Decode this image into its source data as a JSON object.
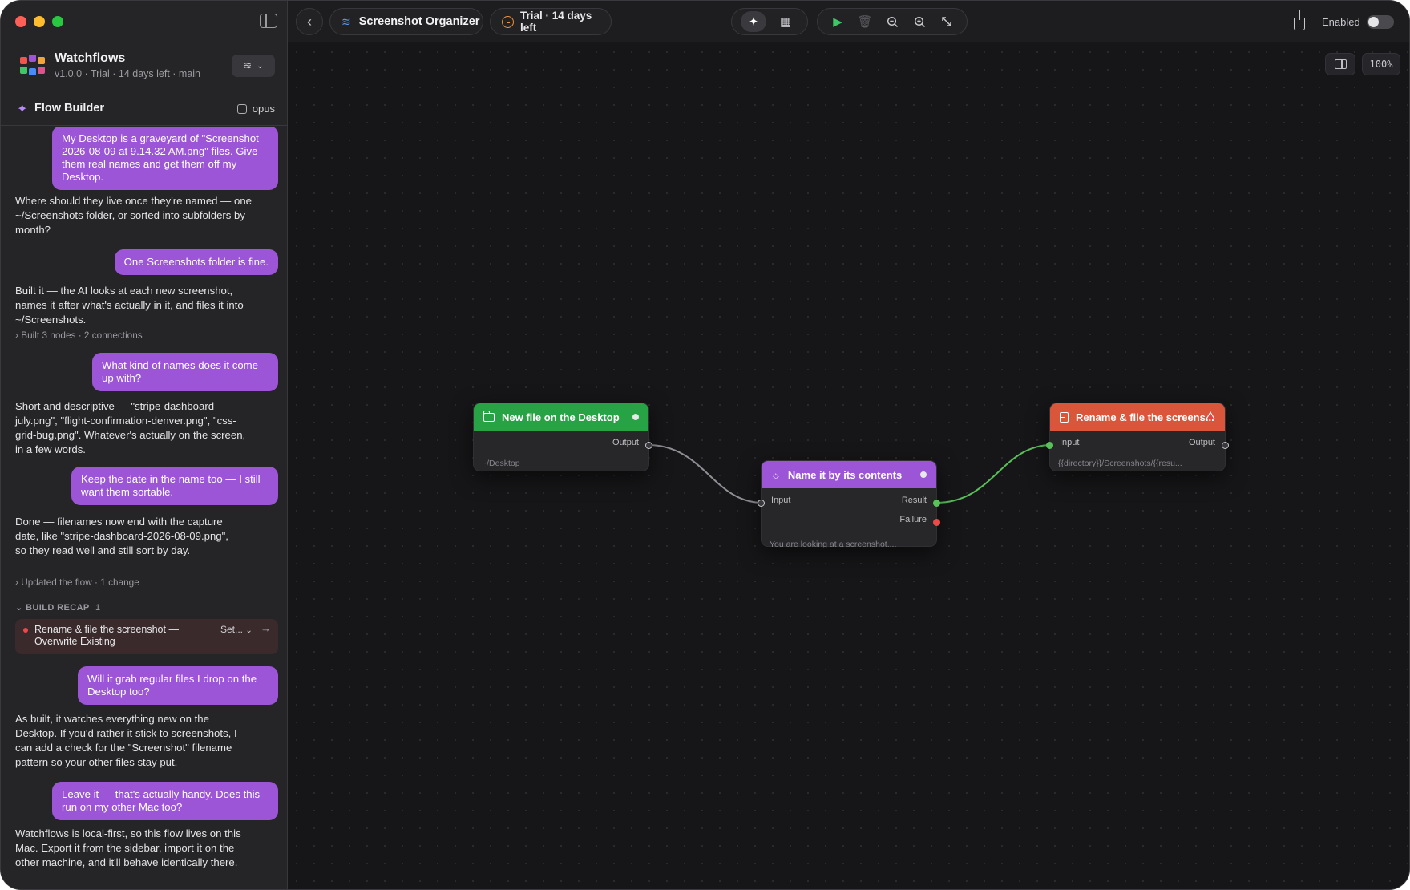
{
  "app": {
    "name": "Watchflows",
    "subtitle": "v1.0.0 · Trial · 14 days left · main",
    "menu_icon": "filter-icon"
  },
  "flow_builder": {
    "title": "Flow Builder",
    "model": "opus"
  },
  "chat": {
    "m1": "My Desktop is a graveyard of \"Screenshot 2026-08-09 at 9.14.32 AM.png\" files. Give them real names and get them off my Desktop.",
    "a1": "Where should they live once they're named — one ~/Screenshots folder, or sorted into subfolders by month?",
    "m2": "One Screenshots folder is fine.",
    "a2": "Built it — the AI looks at each new screenshot, names it after what's actually in it, and files it into ~/Screenshots.",
    "meta1": "Built 3 nodes · 2 connections",
    "m3": "What kind of names does it come up with?",
    "a3": "Short and descriptive — \"stripe-dashboard-july.png\", \"flight-confirmation-denver.png\", \"css-grid-bug.png\". Whatever's actually on the screen, in a few words.",
    "m4": "Keep the date in the name too — I still want them sortable.",
    "a4": "Done — filenames now end with the capture date, like \"stripe-dashboard-2026-08-09.png\", so they read well and still sort by day.",
    "meta2": "Updated the flow · 1 change",
    "recap_header": "BUILD RECAP",
    "recap_count": "1",
    "recap_item": "Rename & file the screenshot — Overwrite Existing",
    "recap_setting": "Set...",
    "m5": "Will it grab regular files I drop on the Desktop too?",
    "a5": "As built, it watches everything new on the Desktop. If you'd rather it stick to screenshots, I can add a check for the \"Screenshot\" filename pattern so your other files stay put.",
    "m6": "Leave it — that's actually handy. Does this run on my other Mac too?",
    "a6": "Watchflows is local-first, so this flow lives on this Mac. Export it from the sidebar, import it on the other machine, and it'll behave identically there."
  },
  "topbar": {
    "flow_title": "Screenshot Organizer",
    "trial": "Trial · 14 days left",
    "enabled_label": "Enabled",
    "enabled": false
  },
  "canvas": {
    "zoom": "100%"
  },
  "nodes": {
    "trigger": {
      "title": "New file on the Desktop",
      "output": "Output",
      "detail": "~/Desktop",
      "color": "#27a244"
    },
    "ai": {
      "title": "Name it by its contents",
      "input": "Input",
      "result": "Result",
      "failure": "Failure",
      "detail": "You are looking at a screenshot....",
      "color": "#9b55d6"
    },
    "action": {
      "title": "Rename & file the screens...",
      "input": "Input",
      "output": "Output",
      "detail": "{{directory}}/Screenshots/{{resu...",
      "color": "#d9563b"
    }
  },
  "colors": {
    "accent_purple": "#9b55d6",
    "success_green": "#3ec766",
    "error_red": "#f04848"
  }
}
